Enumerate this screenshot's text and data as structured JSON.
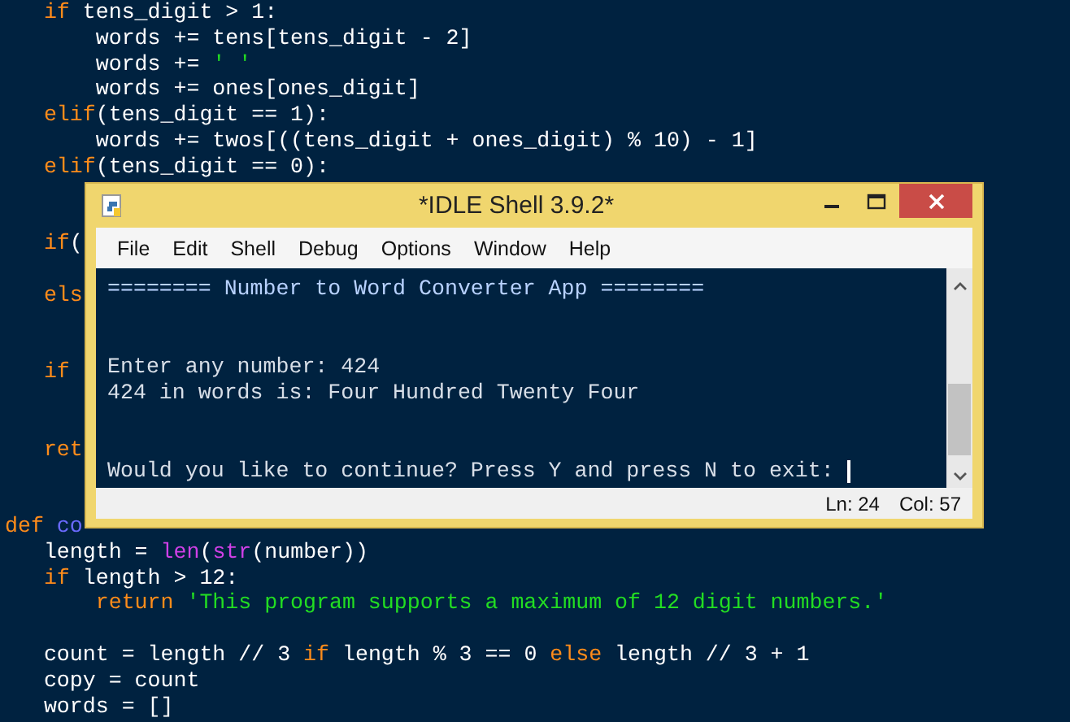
{
  "editor": {
    "lines": [
      {
        "kind": "code",
        "tokens": [
          {
            "t": "   if",
            "kind": "keyword"
          },
          {
            "t": " tens_digit > 1:",
            "kind": "plain"
          }
        ]
      },
      {
        "kind": "code",
        "tokens": [
          {
            "t": "       words += tens[tens_digit - 2]",
            "kind": "plain"
          }
        ]
      },
      {
        "kind": "code",
        "tokens": [
          {
            "t": "       words += ",
            "kind": "plain"
          },
          {
            "t": "' '",
            "kind": "string"
          }
        ]
      },
      {
        "kind": "code",
        "tokens": [
          {
            "t": "       words += ones[ones_digit]",
            "kind": "plain"
          }
        ]
      },
      {
        "kind": "code",
        "tokens": [
          {
            "t": "   elif",
            "kind": "keyword"
          },
          {
            "t": "(tens_digit == 1):",
            "kind": "plain"
          }
        ]
      },
      {
        "kind": "code",
        "tokens": [
          {
            "t": "       words += twos[((tens_digit + ones_digit) % 10) - 1]",
            "kind": "plain"
          }
        ]
      },
      {
        "kind": "code",
        "tokens": [
          {
            "t": "   elif",
            "kind": "keyword"
          },
          {
            "t": "(tens_digit == 0):",
            "kind": "plain"
          }
        ]
      },
      {
        "kind": "blank"
      },
      {
        "kind": "blank"
      },
      {
        "kind": "code",
        "tokens": [
          {
            "t": "   if",
            "kind": "keyword"
          },
          {
            "t": "(",
            "kind": "plain"
          }
        ]
      },
      {
        "kind": "blank"
      },
      {
        "kind": "code",
        "tokens": [
          {
            "t": "   els",
            "kind": "keyword"
          }
        ]
      },
      {
        "kind": "blank"
      },
      {
        "kind": "blank"
      },
      {
        "kind": "code",
        "tokens": [
          {
            "t": "   if",
            "kind": "keyword"
          }
        ]
      },
      {
        "kind": "blank"
      },
      {
        "kind": "blank"
      },
      {
        "kind": "code",
        "tokens": [
          {
            "t": "   ret",
            "kind": "keyword"
          }
        ]
      },
      {
        "kind": "blank"
      },
      {
        "kind": "blank"
      },
      {
        "kind": "code",
        "tokens": [
          {
            "t": "def",
            "kind": "keyword"
          },
          {
            "t": " co",
            "kind": "definition"
          }
        ]
      },
      {
        "kind": "code",
        "tokens": [
          {
            "t": "   length = ",
            "kind": "plain"
          },
          {
            "t": "len",
            "kind": "builtin"
          },
          {
            "t": "(",
            "kind": "plain"
          },
          {
            "t": "str",
            "kind": "builtin"
          },
          {
            "t": "(number))",
            "kind": "plain"
          }
        ]
      },
      {
        "kind": "code",
        "tokens": [
          {
            "t": "   if",
            "kind": "keyword"
          },
          {
            "t": " length > 12:",
            "kind": "plain"
          }
        ]
      },
      {
        "kind": "code",
        "tokens": [
          {
            "t": "       return",
            "kind": "keyword"
          },
          {
            "t": " 'This program supports a maximum of 12 digit numbers.'",
            "kind": "string"
          }
        ]
      },
      {
        "kind": "blank"
      },
      {
        "kind": "code",
        "tokens": [
          {
            "t": "   count = length // 3 ",
            "kind": "plain"
          },
          {
            "t": "if",
            "kind": "keyword"
          },
          {
            "t": " length % 3 == 0 ",
            "kind": "plain"
          },
          {
            "t": "else",
            "kind": "keyword"
          },
          {
            "t": " length // 3 + 1",
            "kind": "plain"
          }
        ]
      },
      {
        "kind": "code",
        "tokens": [
          {
            "t": "   copy = count",
            "kind": "plain"
          }
        ]
      },
      {
        "kind": "code",
        "tokens": [
          {
            "t": "   words = []",
            "kind": "plain"
          }
        ]
      }
    ]
  },
  "window": {
    "title": "*IDLE Shell 3.9.2*",
    "menu": [
      "File",
      "Edit",
      "Shell",
      "Debug",
      "Options",
      "Window",
      "Help"
    ],
    "shell_lines": [
      {
        "kind": "banner",
        "text": "======== Number to Word Converter App ========"
      },
      {
        "kind": "blank"
      },
      {
        "kind": "blank"
      },
      {
        "kind": "output",
        "text": "Enter any number: 424"
      },
      {
        "kind": "output",
        "text": "424 in words is: Four Hundred Twenty Four"
      },
      {
        "kind": "blank"
      },
      {
        "kind": "blank"
      },
      {
        "kind": "prompt",
        "text": "Would you like to continue? Press Y and press N to exit:"
      }
    ],
    "status_bar": {
      "line": "Ln: 24",
      "column": "Col: 57"
    }
  }
}
